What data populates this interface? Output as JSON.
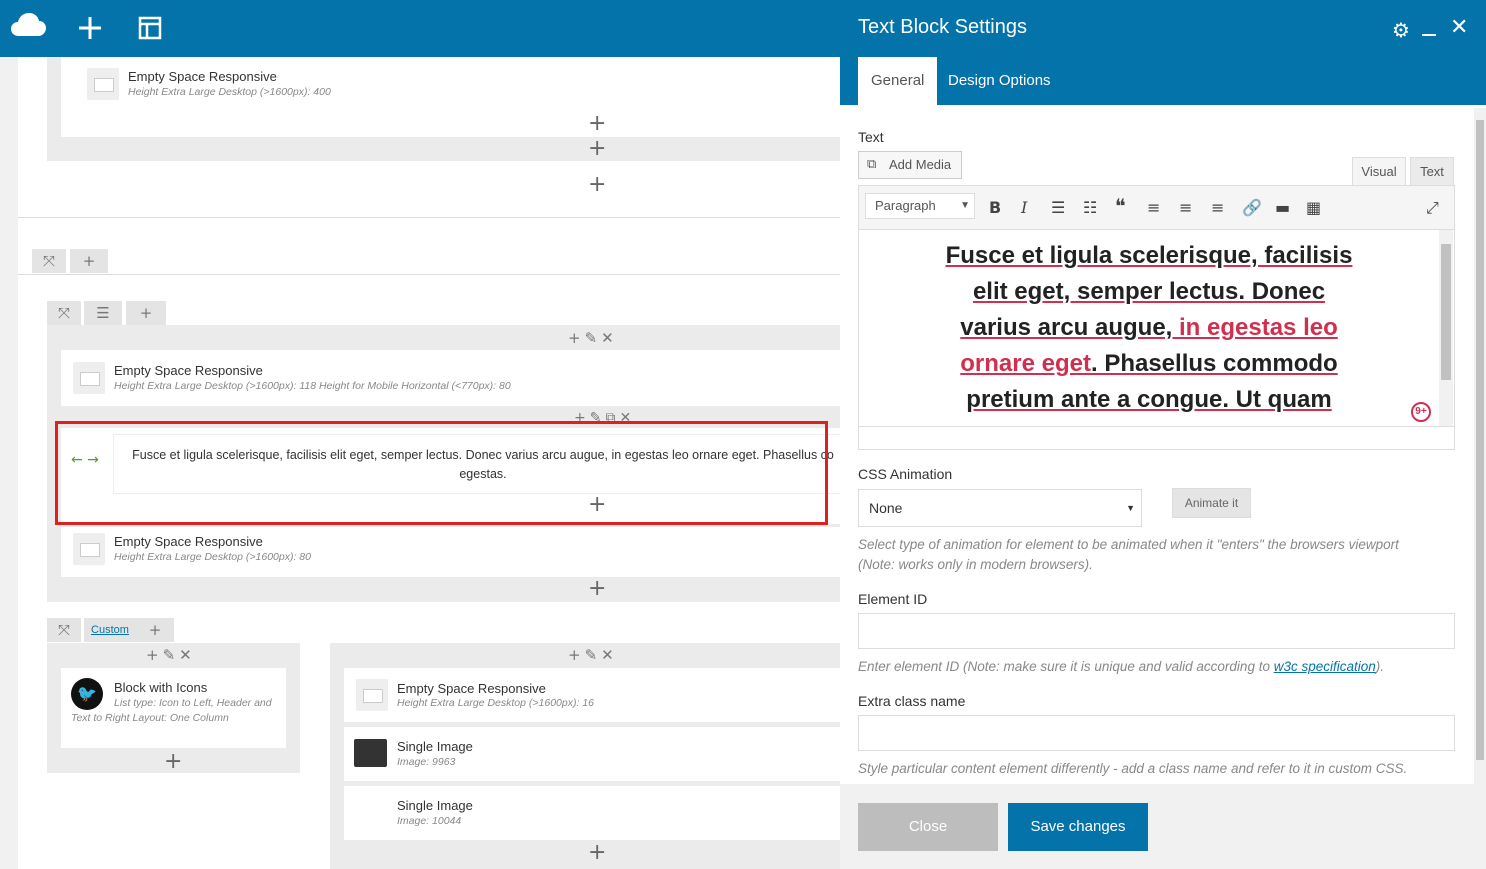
{
  "builder": {
    "rows": [
      {
        "title": "Empty Space Responsive",
        "sub": "Height Extra Large Desktop (>1600px): 400"
      },
      {
        "title": "Empty Space Responsive",
        "sub": "Height Extra Large Desktop (>1600px): 118  Height for Mobile Horizontal (<770px): 80"
      },
      {
        "title": "Empty Space Responsive",
        "sub": "Height Extra Large Desktop (>1600px): 80"
      },
      {
        "title": "Block with Icons",
        "sub": "List type: Icon to Left, Header and Text to Right  Layout: One Column"
      },
      {
        "title": "Empty Space Responsive",
        "sub": "Height Extra Large Desktop (>1600px): 16"
      },
      {
        "title": "Single Image",
        "sub": "Image: 9963"
      },
      {
        "title": "Single Image",
        "sub": "Image: 10044"
      }
    ],
    "text_block": "Fusce et ligula scelerisque, facilisis elit eget, semper lectus. Donec varius arcu augue, in egestas leo ornare eget. Phasellus commodo pretium ante a congue. Ut quam egestas.",
    "text_block_visible_line1": "Fusce et ligula scelerisque, facilisis elit eget, semper lectus. Donec varius arcu augue, in egestas leo ornare eget. Phasellus co",
    "text_block_visible_line2": "egestas.",
    "custom_tab": "Custom"
  },
  "panel": {
    "title": "Text Block Settings",
    "tabs": [
      "General",
      "Design Options"
    ],
    "text_label": "Text",
    "add_media": "Add Media",
    "editor_tabs": [
      "Visual",
      "Text"
    ],
    "format_select": "Paragraph",
    "editor_content": {
      "line1": "Fusce et ligula scelerisque, facilisis",
      "line2": "elit eget, semper lectus. Donec",
      "line3a": "varius arcu augue, ",
      "line3b": "in egestas leo",
      "line4a": "ornare eget",
      "line4b": ". Phasellus commodo",
      "line5": "pretium ante a congue. Ut quam"
    },
    "badge": "9+",
    "css_anim_label": "CSS Animation",
    "css_anim_value": "None",
    "animate_btn": "Animate it",
    "css_anim_help": "Select type of animation for element to be animated when it \"enters\" the browsers viewport (Note: works only in modern browsers).",
    "element_id_label": "Element ID",
    "element_id_help_a": "Enter element ID (Note: make sure it is unique and valid according to ",
    "element_id_help_link": "w3c specification",
    "element_id_help_b": ").",
    "extra_class_label": "Extra class name",
    "extra_class_help": "Style particular content element differently - add a class name and refer to it in custom CSS.",
    "close_btn": "Close",
    "save_btn": "Save changes"
  },
  "colors": {
    "accent": "#0473aa",
    "highlight": "#e0201f",
    "text_red": "#d0304e"
  }
}
